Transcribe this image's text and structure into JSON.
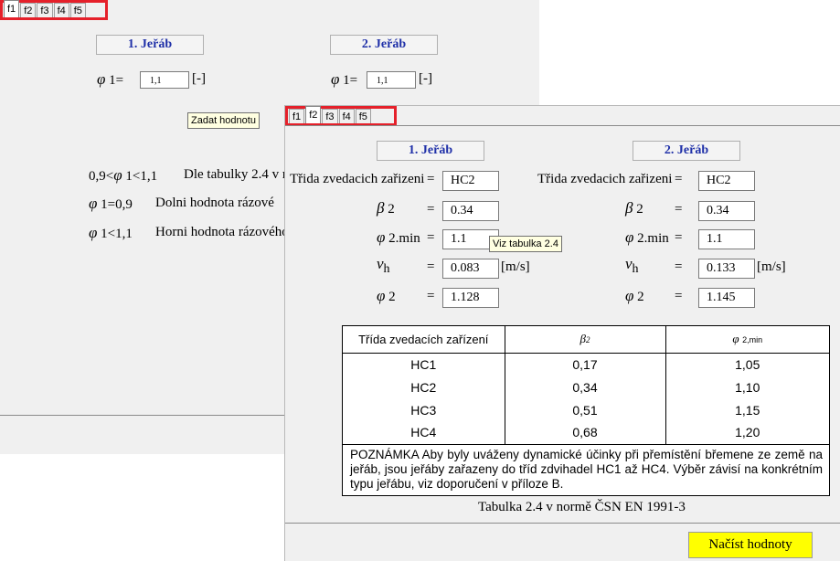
{
  "win1": {
    "tabs": [
      "f1",
      "f2",
      "f3",
      "f4",
      "f5"
    ],
    "crane1_label": "1. Jeřáb",
    "crane2_label": "2. Jeřáb",
    "phi1_label": "1=",
    "phi1_value_1": "1,1",
    "phi1_value_2": "1,1",
    "unit_dimensionless": "[-]",
    "tooltip": "Zadat hodnotu",
    "info_line1_prefix": "0,9<",
    "info_line1_mid": " 1<1,1",
    "info_line1_text": "Dle tabulky 2.4 v n",
    "info_line2_mid": " 1=0,9",
    "info_line2_text": "Dolni hodnota rázové",
    "info_line3_mid": " 1<1,1",
    "info_line3_text": "Horni hodnota rázového"
  },
  "win2": {
    "tabs": [
      "f1",
      "f2",
      "f3",
      "f4",
      "f5"
    ],
    "crane1_label": "1. Jeřáb",
    "crane2_label": "2. Jeřáb",
    "class_label": "Třida zvedacich zařizeni",
    "eq": "=",
    "beta2": "2",
    "phi2min": "2.min",
    "vh_sub": "h",
    "phi2": "2",
    "unit_ms": "[m/s]",
    "crane1": {
      "class": "HC2",
      "beta2": "0.34",
      "phi2min": "1.1",
      "vh": "0.083",
      "phi2": "1.128"
    },
    "crane2": {
      "class": "HC2",
      "beta2": "0.34",
      "phi2min": "1.1",
      "vh": "0.133",
      "phi2": "1.145"
    },
    "tooltip": "Viz tabulka 2.4",
    "table": {
      "header": [
        "Třída zvedacích zařízení",
        "2",
        "2,min"
      ],
      "rows": [
        [
          "HC1",
          "0,17",
          "1,05"
        ],
        [
          "HC2",
          "0,34",
          "1,10"
        ],
        [
          "HC3",
          "0,51",
          "1,15"
        ],
        [
          "HC4",
          "0,68",
          "1,20"
        ]
      ],
      "note_bold": "POZNÁMKA",
      "note": "  Aby byly uváženy dynamické účinky při přemístění břemene ze země na jeřáb, jsou jeřáby zařazeny do tříd zdvihadel HC1 až HC4. Výběr závisí na konkrétním typu jeřábu, viz doporučení v příloze B."
    },
    "caption": "Tabulka 2.4 v normě ČSN EN 1991-3",
    "load_button": "Načíst hodnoty"
  }
}
